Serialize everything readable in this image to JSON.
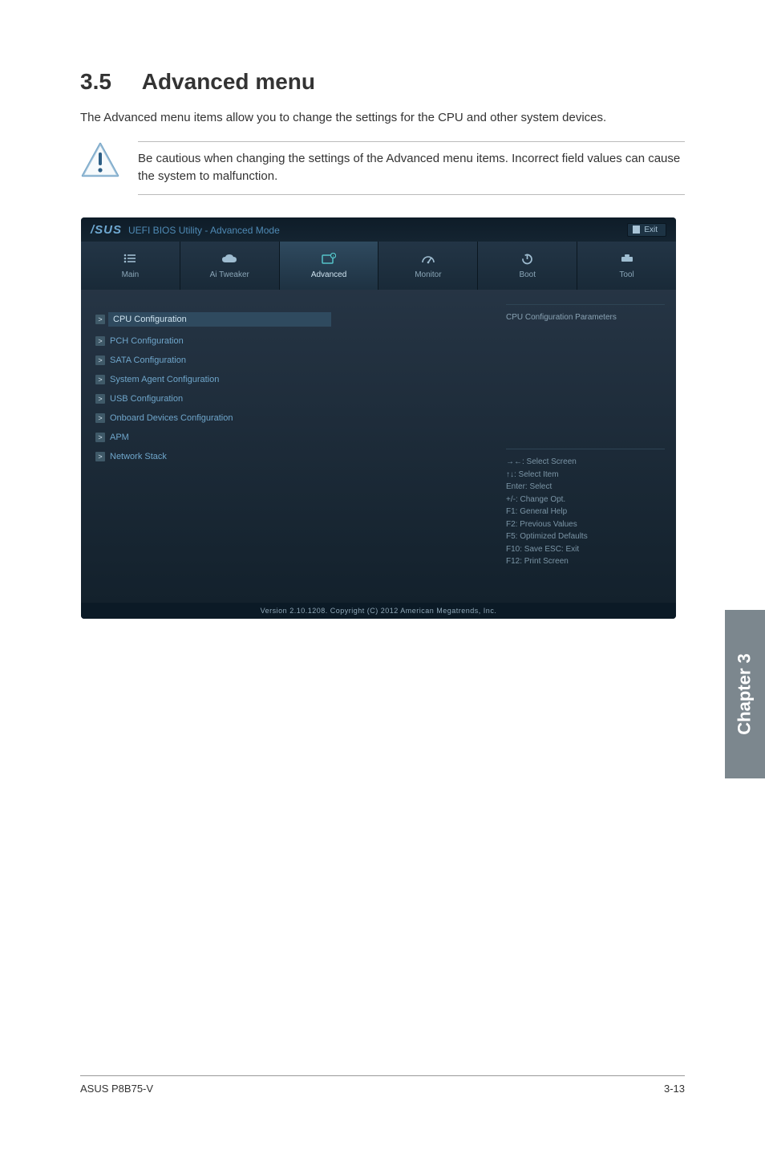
{
  "section": {
    "number": "3.5",
    "title": "Advanced menu"
  },
  "intro": "The Advanced menu items allow you to change the settings for the CPU and other system devices.",
  "caution": "Be cautious when changing the settings of the Advanced menu items. Incorrect field values can cause the system to malfunction.",
  "bios": {
    "logo": "/SUS",
    "title": "UEFI BIOS Utility - Advanced Mode",
    "exit": "Exit",
    "tabs": [
      {
        "label": "Main"
      },
      {
        "label": "Ai  Tweaker"
      },
      {
        "label": "Advanced",
        "selected": true
      },
      {
        "label": "Monitor"
      },
      {
        "label": "Boot"
      },
      {
        "label": "Tool"
      }
    ],
    "menu": [
      {
        "label": "CPU Configuration",
        "selected": true
      },
      {
        "label": "PCH Configuration"
      },
      {
        "label": "SATA Configuration"
      },
      {
        "label": "System Agent Configuration"
      },
      {
        "label": "USB Configuration"
      },
      {
        "label": "Onboard Devices Configuration"
      },
      {
        "label": "APM"
      },
      {
        "label": "Network Stack"
      }
    ],
    "help_title": "CPU Configuration Parameters",
    "keys": [
      "→←: Select Screen",
      "↑↓: Select Item",
      "Enter: Select",
      "+/-: Change Opt.",
      "F1: General Help",
      "F2: Previous Values",
      "F5: Optimized Defaults",
      "F10: Save   ESC: Exit",
      "F12: Print Screen"
    ],
    "footer": "Version  2.10.1208.   Copyright  (C)  2012  American  Megatrends,  Inc."
  },
  "chapter_tab": "Chapter 3",
  "footer": {
    "left": "ASUS P8B75-V",
    "right": "3-13"
  }
}
